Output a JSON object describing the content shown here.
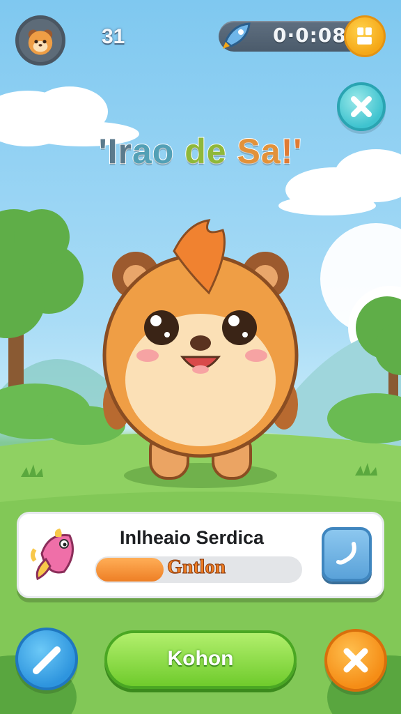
{
  "hud": {
    "level": "31",
    "timer": "0·0:08",
    "avatar_icon": "bear-face-icon",
    "timer_icon": "rocket-icon",
    "menu_icon": "grid-menu-icon",
    "close_icon": "close-icon"
  },
  "title": {
    "parts": [
      "'Ir",
      "ao",
      "de",
      "Sa",
      "!'"
    ],
    "colors": [
      "#5b7a8c",
      "#52a0b6",
      "#8fb83a",
      "#e2923a",
      "#e07b34"
    ]
  },
  "pet": {
    "icon": "bear-character-icon"
  },
  "card": {
    "item_icon": "pink-fish-icon",
    "title": "Inlheaio Serdica",
    "progress_label": "Gntlon",
    "progress": 0.33,
    "action_icon": "edit-icon"
  },
  "bottom": {
    "left_icon": "pencil-icon",
    "main_label": "Kohon",
    "right_icon": "close-icon"
  },
  "colors": {
    "sky": "#7fc8f0",
    "grass": "#8fd06a",
    "accent_green": "#6fcb2c",
    "accent_orange": "#f58d16",
    "accent_blue": "#2e95de",
    "accent_teal": "#3fc3cf"
  }
}
